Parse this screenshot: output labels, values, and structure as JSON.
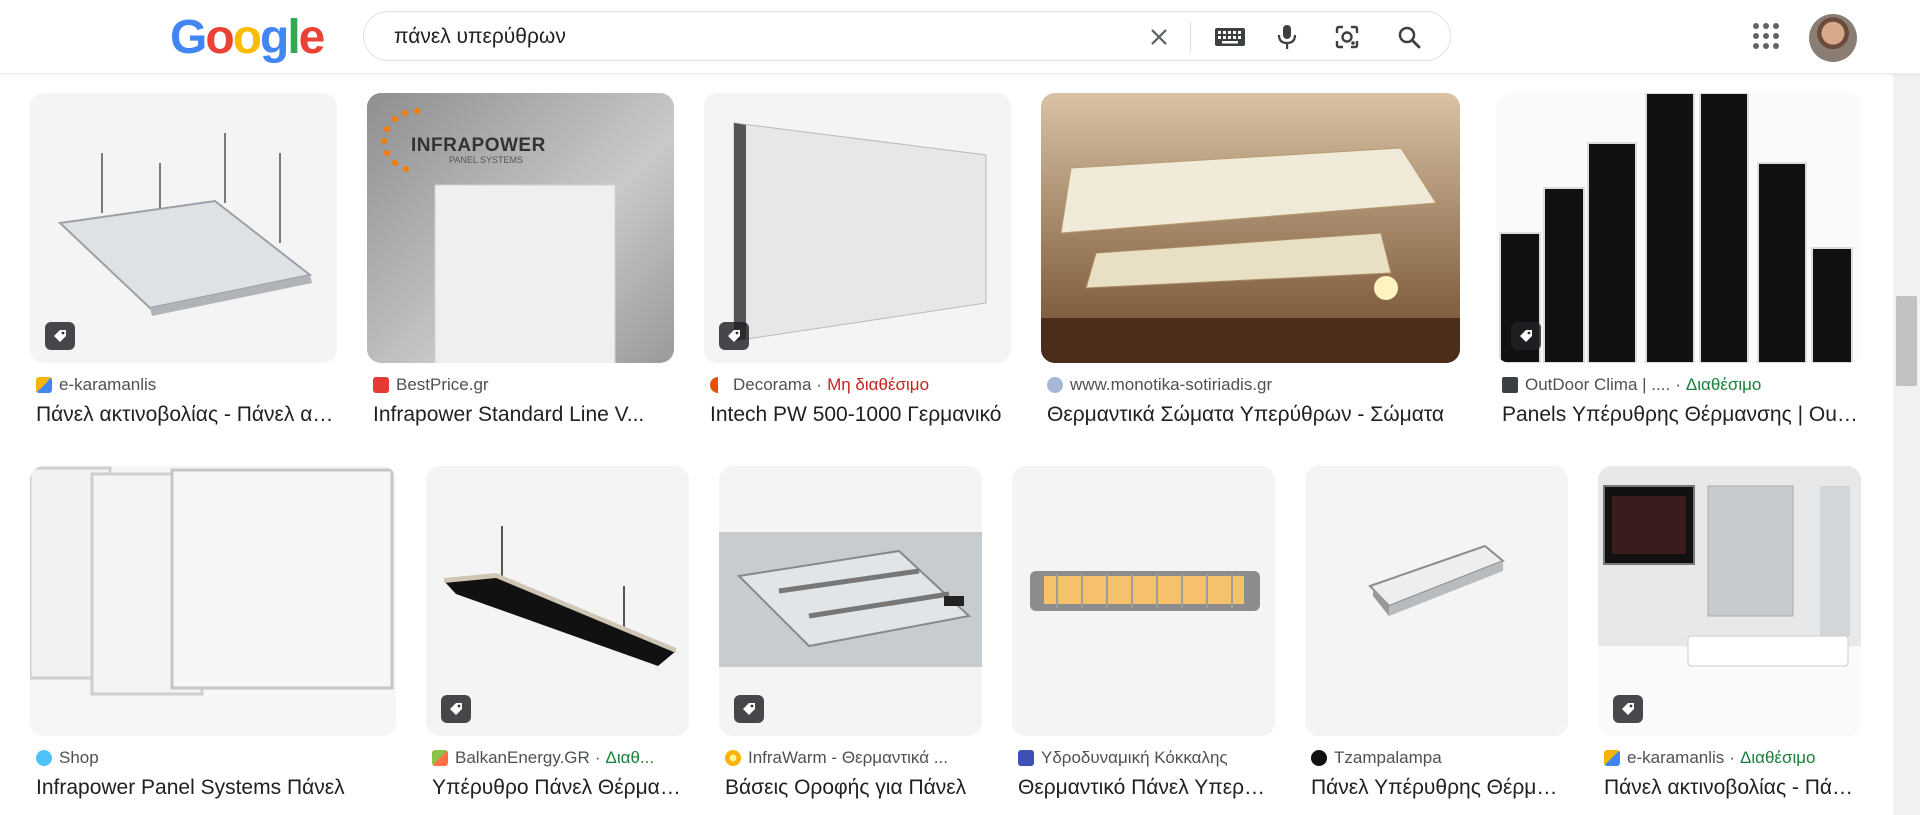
{
  "header": {
    "logo_letters": [
      "G",
      "o",
      "o",
      "g",
      "l",
      "e"
    ],
    "logo_colors": [
      "#4285f4",
      "#ea4335",
      "#fbbc05",
      "#4285f4",
      "#34a853",
      "#ea4335"
    ],
    "query": "πάνελ υπερύθρων",
    "icons": [
      "clear-icon",
      "keyboard-icon",
      "microphone-icon",
      "lens-icon",
      "search-icon",
      "apps-grid-icon"
    ]
  },
  "results": [
    {
      "source": "e-karamanlis",
      "status": "",
      "title": "Πάνελ ακτινοβολίας - Πάνελ ακτινοβολίας",
      "has_tag": true
    },
    {
      "source": "BestPrice.gr",
      "status": "",
      "title": "Infrapower Standard Line V...",
      "has_tag": false,
      "overlay_brand": "INFRAPOWER",
      "overlay_sub": "PANEL SYSTEMS"
    },
    {
      "source": "Decorama",
      "status": "Μη διαθέσιμο",
      "title": "Intech PW 500-1000 Γερμανικό",
      "has_tag": true
    },
    {
      "source": "www.monotika-sotiriadis.gr",
      "status": "",
      "title": "Θερμαντικά Σώματα Υπερύθρων - Σώματα",
      "has_tag": false
    },
    {
      "source": "OutDoor Clima | ....",
      "status": "Διαθέσιμο",
      "title": "Panels Υπέρυθρης Θέρμανσης | OutDoor",
      "has_tag": true
    },
    {
      "source": "Shop",
      "status": "",
      "title": "Infrapower Panel Systems Πάνελ",
      "has_tag": false
    },
    {
      "source": "BalkanEnergy.GR",
      "status": "Διαθ...",
      "title": "Υπέρυθρο Πάνελ Θέρμανσης",
      "has_tag": true
    },
    {
      "source": "InfraWarm - Θερμαντικά ...",
      "status": "",
      "title": "Βάσεις Οροφής για Πάνελ",
      "has_tag": true
    },
    {
      "source": "Υδροδυναμική Κόκκαλης",
      "status": "",
      "title": "Θερμαντικό Πάνελ Υπερύθρων",
      "has_tag": false
    },
    {
      "source": "Tzampalampa",
      "status": "",
      "title": "Πάνελ Υπέρυθρης Θέρμανσης",
      "has_tag": false
    },
    {
      "source": "e-karamanlis",
      "status": "Διαθέσιμο",
      "title": "Πάνελ ακτινοβολίας - Πάνελ",
      "has_tag": true
    }
  ],
  "colors": {
    "available": "#188038",
    "unavailable": "#c5221f"
  }
}
